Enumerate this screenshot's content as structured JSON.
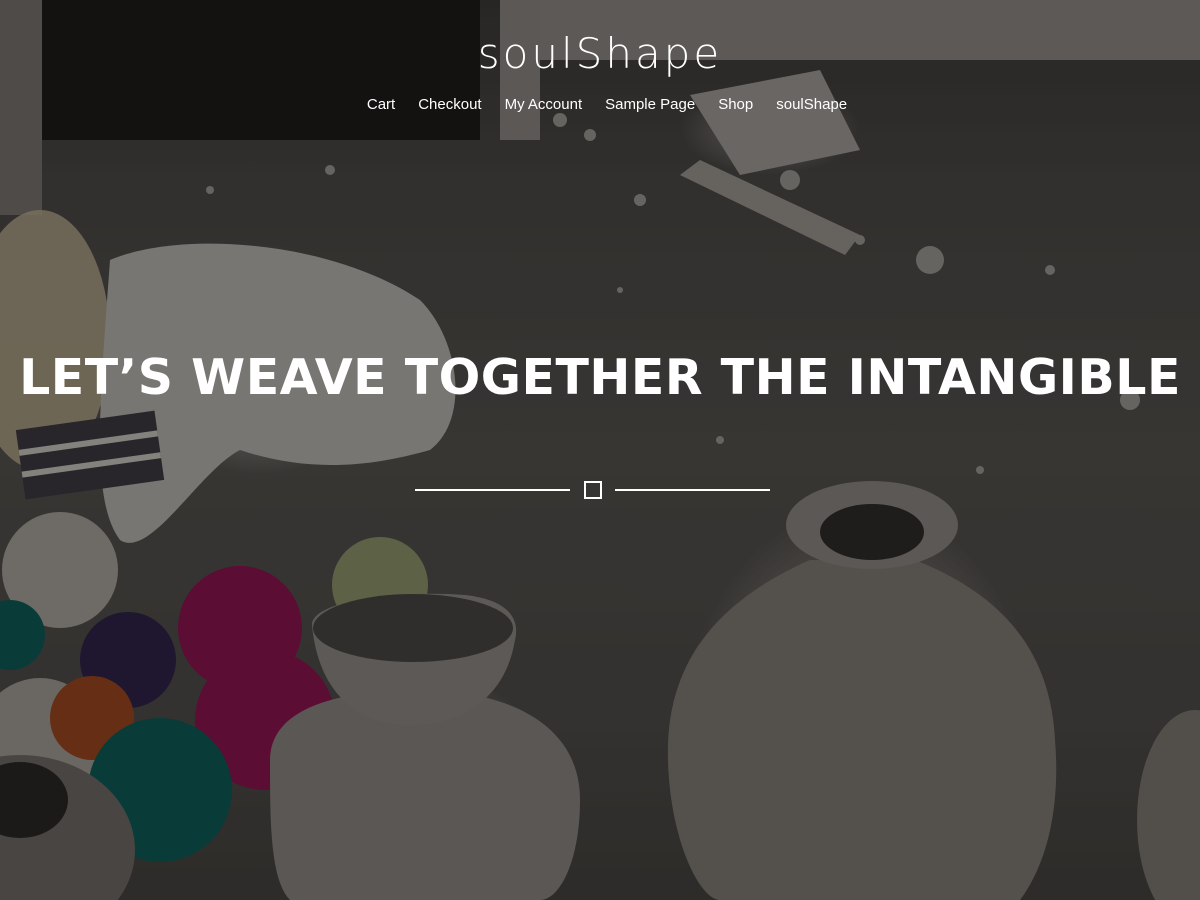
{
  "site": {
    "title": "soulShape"
  },
  "nav": {
    "items": [
      {
        "label": "Cart"
      },
      {
        "label": "Checkout"
      },
      {
        "label": "My Account"
      },
      {
        "label": "Sample Page"
      },
      {
        "label": "Shop"
      },
      {
        "label": "soulShape"
      }
    ]
  },
  "hero": {
    "headline": "LET’S WEAVE TOGETHER THE INTANGIBLE",
    "divider_icon": "square-outline-icon"
  },
  "colors": {
    "text": "#ffffff",
    "overlay": "rgba(0,0,0,0.34)",
    "yarn_magenta": "#8a1550",
    "yarn_teal": "#0f5a55",
    "yarn_purple": "#2e2348",
    "yarn_orange": "#9a4620"
  }
}
